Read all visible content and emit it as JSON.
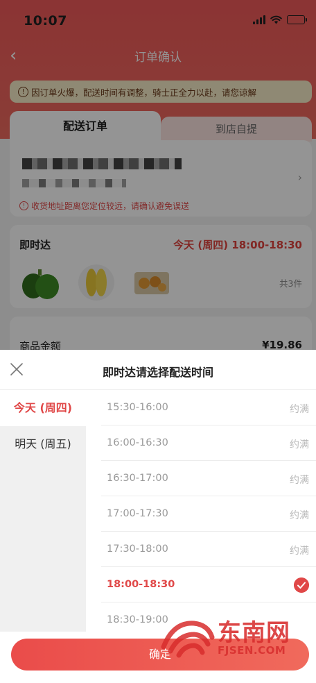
{
  "status_bar": {
    "time": "10:07"
  },
  "nav": {
    "title": "订单确认"
  },
  "notice": {
    "icon": "info-icon",
    "text": "因订单火爆，配送时间有调整，骑士正全力以赴，请您谅解"
  },
  "tabs": {
    "delivery": "配送订单",
    "pickup": "到店自提"
  },
  "address": {
    "warning": "收货地址距离您定位较远，请确认避免误送"
  },
  "delivery": {
    "label": "即时达",
    "time": "今天 (周四) 18:00-18:30",
    "count": "共3件"
  },
  "amount": {
    "label": "商品金额",
    "value": "¥19.86"
  },
  "sheet": {
    "title": "即时达请选择配送时间",
    "days": [
      {
        "label": "今天 (周四)",
        "active": true
      },
      {
        "label": "明天 (周五)",
        "active": false
      }
    ],
    "slots": [
      {
        "time": "15:30-16:00",
        "status": "约满"
      },
      {
        "time": "16:00-16:30",
        "status": "约满"
      },
      {
        "time": "16:30-17:00",
        "status": "约满"
      },
      {
        "time": "17:00-17:30",
        "status": "约满"
      },
      {
        "time": "17:30-18:00",
        "status": "约满"
      },
      {
        "time": "18:00-18:30",
        "status": "",
        "selected": true
      },
      {
        "time": "18:30-19:00",
        "status": ""
      }
    ],
    "confirm": "确定"
  },
  "watermark": {
    "cn": "东南网",
    "en": "FJSEN.COM"
  },
  "colors": {
    "accent": "#e04848",
    "header": "#f05a5a",
    "notice_bg": "#f6ecc8"
  }
}
